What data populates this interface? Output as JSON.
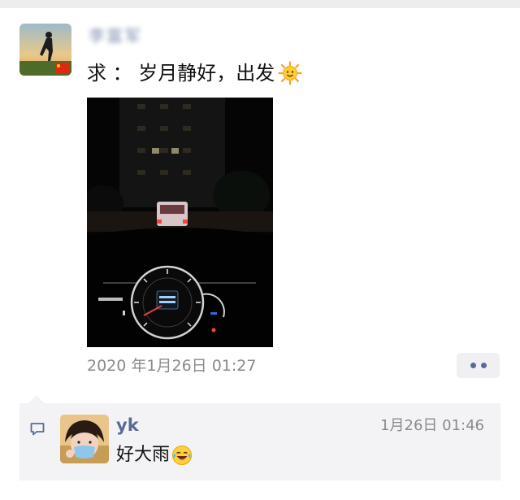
{
  "post": {
    "author_name": "李富军",
    "text": "求 ： 岁月静好，出发",
    "emoji_icon": "sun-emoji-icon",
    "photo_label": "night-driving-dashboard-photo",
    "timestamp": "2020 年1月26日 01:27",
    "more_icon": "more-dots-icon"
  },
  "comment": {
    "icon": "comment-bubble-icon",
    "name": "yk",
    "time": "1月26日 01:46",
    "text": "好大雨",
    "emoji_icon": "laughing-crying-emoji-icon"
  },
  "colors": {
    "link_blue": "#576b95",
    "timestamp_gray": "#8a8a8a",
    "comment_bg": "#f3f3f5"
  }
}
